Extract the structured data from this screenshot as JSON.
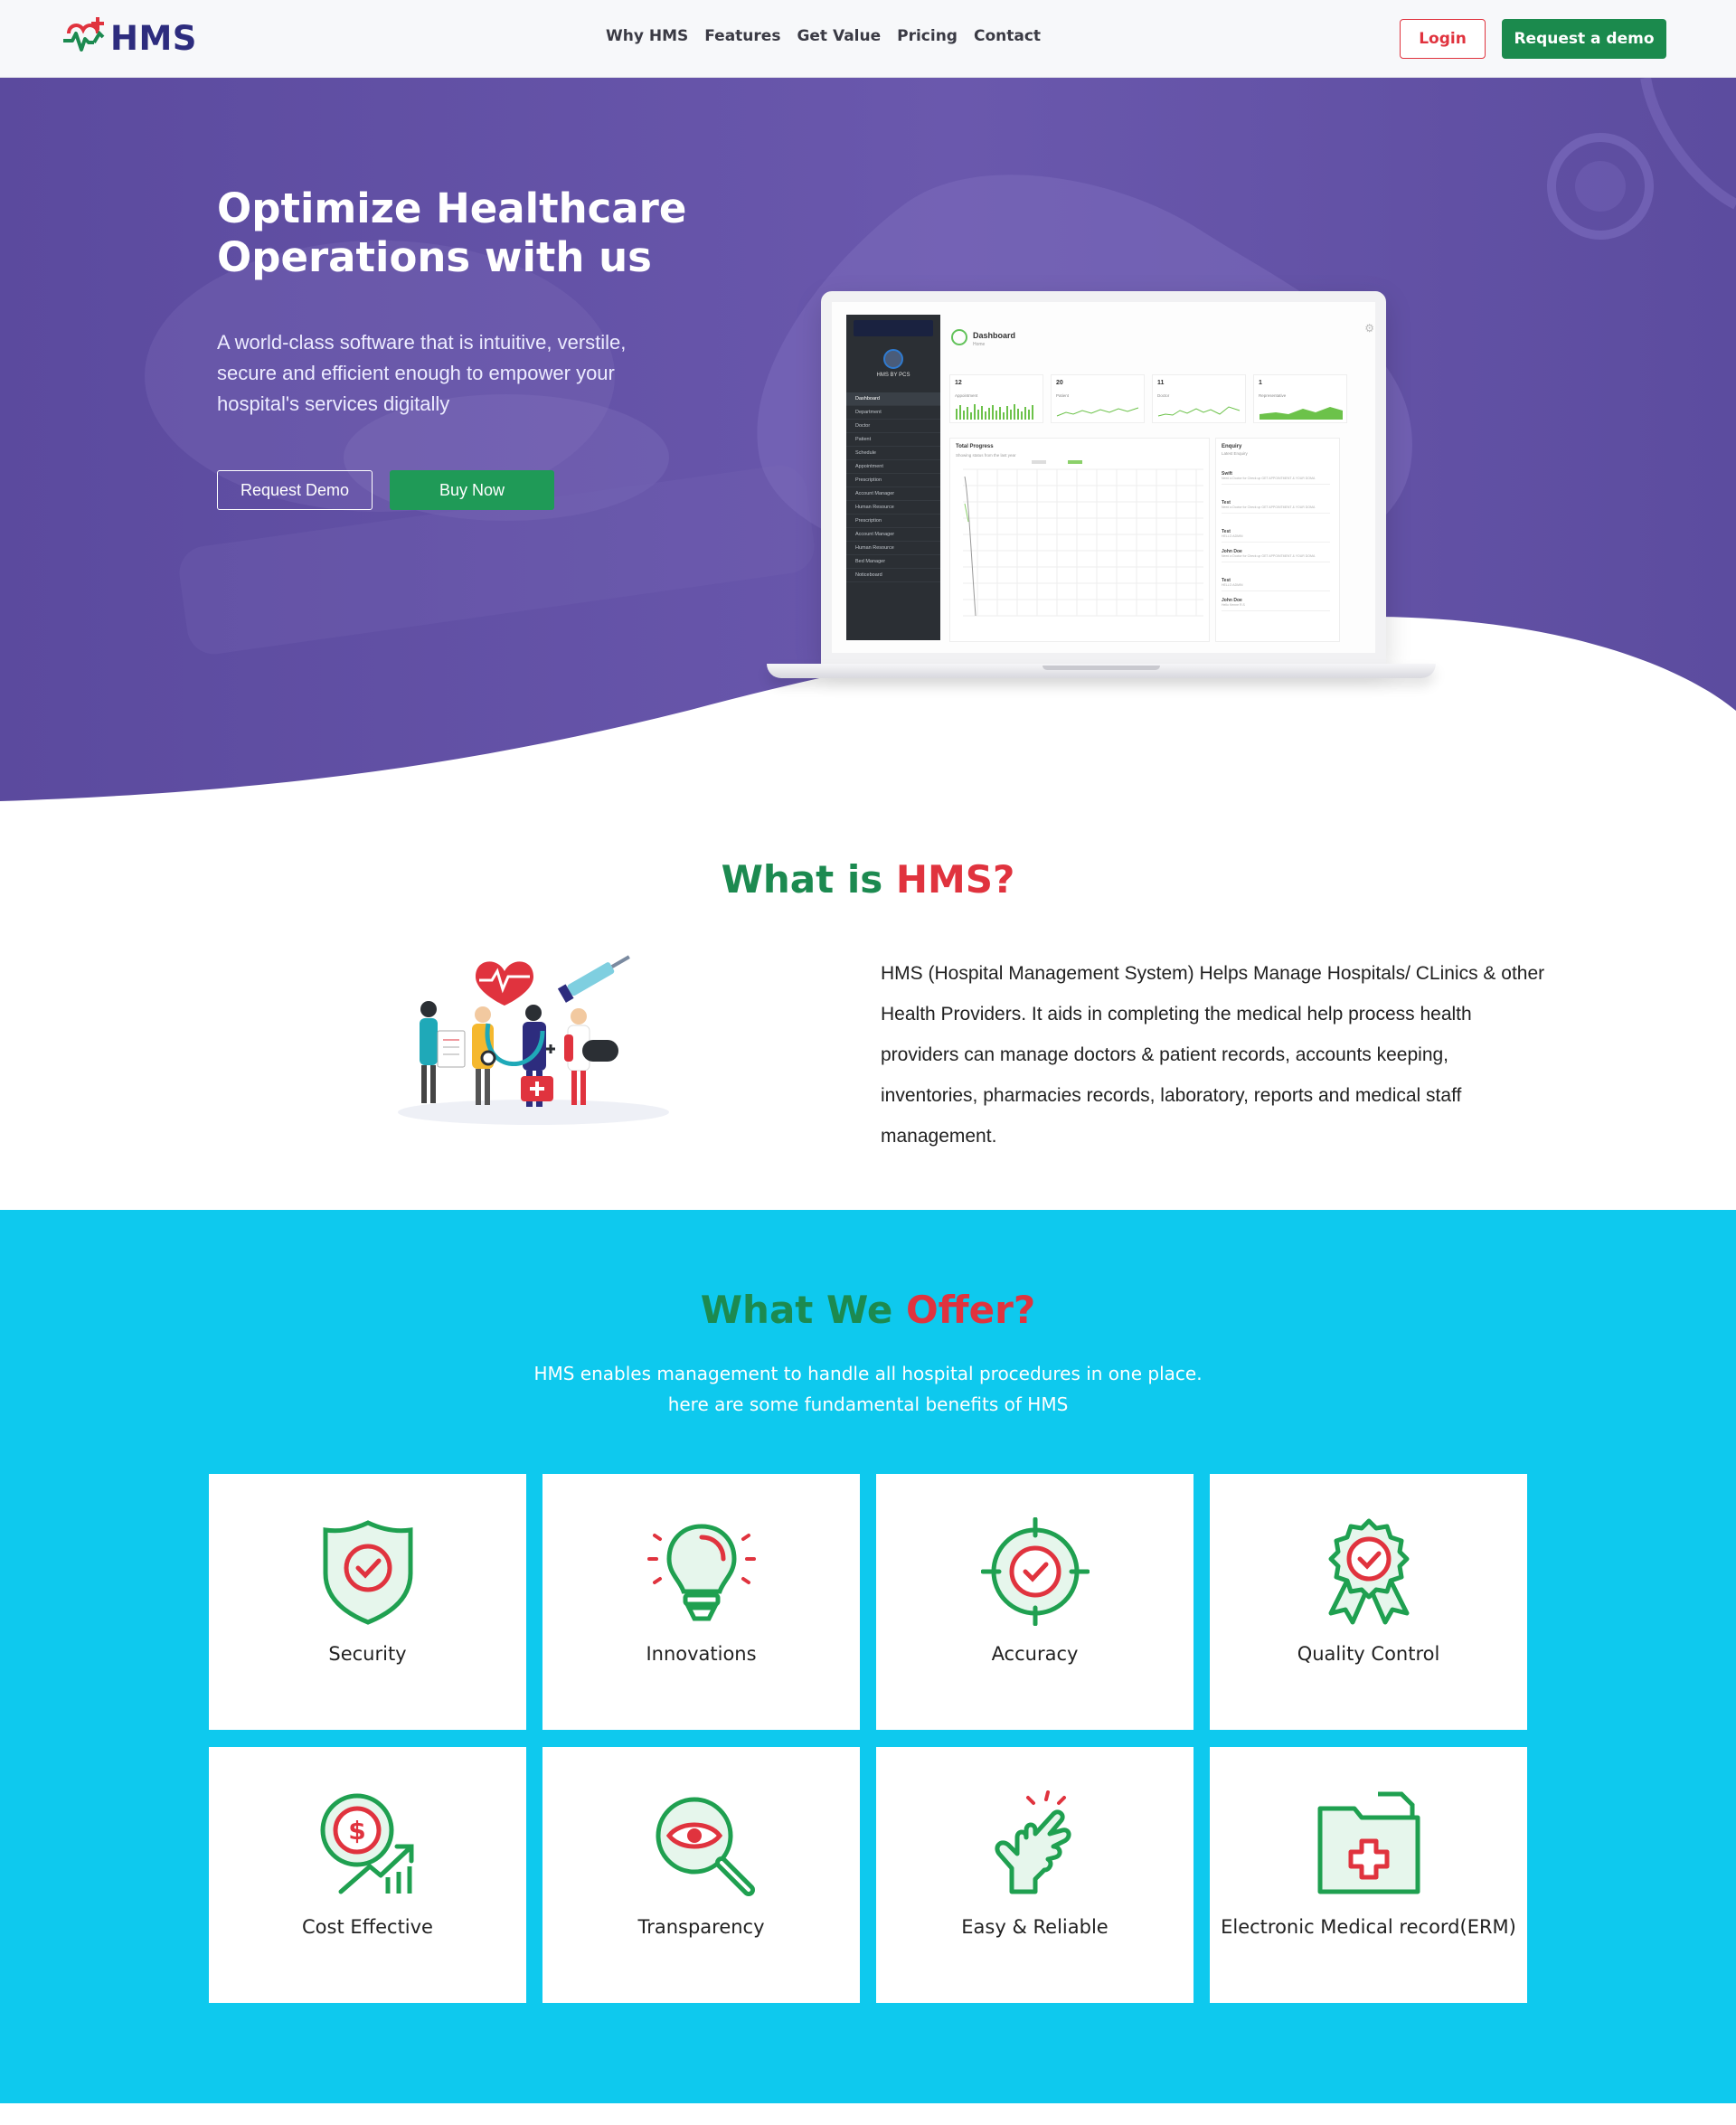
{
  "brand": {
    "name": "HMS"
  },
  "nav": {
    "items": [
      {
        "label": "Why HMS"
      },
      {
        "label": "Features"
      },
      {
        "label": "Get Value"
      },
      {
        "label": "Pricing"
      },
      {
        "label": "Contact"
      }
    ],
    "login_label": "Login",
    "demo_label": "Request a demo"
  },
  "hero": {
    "title": "Optimize Healthcare Operations with us",
    "subtitle": "A world-class software that is intuitive, verstile, secure and efficient enough to empower your hospital's services digitally",
    "btn_request": "Request Demo",
    "btn_buy": "Buy Now"
  },
  "dashboard": {
    "title": "Dashboard",
    "subtitle": "Home",
    "user": "HMS BY PCS",
    "menu": [
      "Dashboard",
      "Department",
      "Doctor",
      "Patient",
      "Schedule",
      "Appointment",
      "Prescription",
      "Account Manager",
      "Human Resource",
      "Prescription",
      "Account Manager",
      "Human Resource",
      "Bed Manager",
      "Noticeboard"
    ],
    "stats": [
      {
        "num": "12",
        "label": "Appointment"
      },
      {
        "num": "20",
        "label": "Patient"
      },
      {
        "num": "11",
        "label": "Doctor"
      },
      {
        "num": "1",
        "label": "Representative"
      }
    ],
    "progress_title": "Total Progress",
    "progress_sub": "Showing status from the last year",
    "enquiry_title": "Enquiry",
    "enquiry_sub": "Latest Enquiry",
    "enquiries": [
      {
        "name": "Swift",
        "text": "Need a Doctor for Check up GET APPOINTMENT & YOUR DOMA"
      },
      {
        "name": "Test",
        "text": "Need a Doctor for Check up GET APPOINTMENT & YOUR DOMA"
      },
      {
        "name": "Test",
        "text": "HELLO ADMIN"
      },
      {
        "name": "John Doe",
        "text": "Need a Doctor for Check up GET APPOINTMENT & YOUR DOMA"
      },
      {
        "name": "Test",
        "text": "HELLO ADMIN"
      },
      {
        "name": "John Doe",
        "text": "Hello Kenne R.S"
      }
    ]
  },
  "what": {
    "title_part1": "What is ",
    "title_part2": "HMS?",
    "text": "HMS (Hospital Management System) Helps Manage Hospitals/ CLinics & other Health Providers. It aids in completing the medical help process health providers can manage doctors & patient records, accounts keeping, inventories, pharmacies records, laboratory, reports and medical staff management."
  },
  "offer": {
    "title_part1": "What We ",
    "title_part2": "Offer?",
    "sub_line1": "HMS enables management to handle all hospital procedures in one place.",
    "sub_line2": "here are some fundamental benefits of HMS",
    "cards": [
      {
        "label": "Security",
        "icon": "shield-check-icon"
      },
      {
        "label": "Innovations",
        "icon": "lightbulb-icon"
      },
      {
        "label": "Accuracy",
        "icon": "target-check-icon"
      },
      {
        "label": "Quality Control",
        "icon": "award-badge-icon"
      },
      {
        "label": "Cost Effective",
        "icon": "dollar-growth-icon"
      },
      {
        "label": "Transparency",
        "icon": "magnifier-eye-icon"
      },
      {
        "label": "Easy & Reliable",
        "icon": "hand-click-icon"
      },
      {
        "label": "Electronic Medical record(ERM)",
        "icon": "medical-folder-icon"
      }
    ]
  },
  "colors": {
    "brand_green": "#1c8a50",
    "brand_red": "#e0333e",
    "hero_purple": "#5a4aa0",
    "offer_cyan": "#0ec9ee"
  }
}
